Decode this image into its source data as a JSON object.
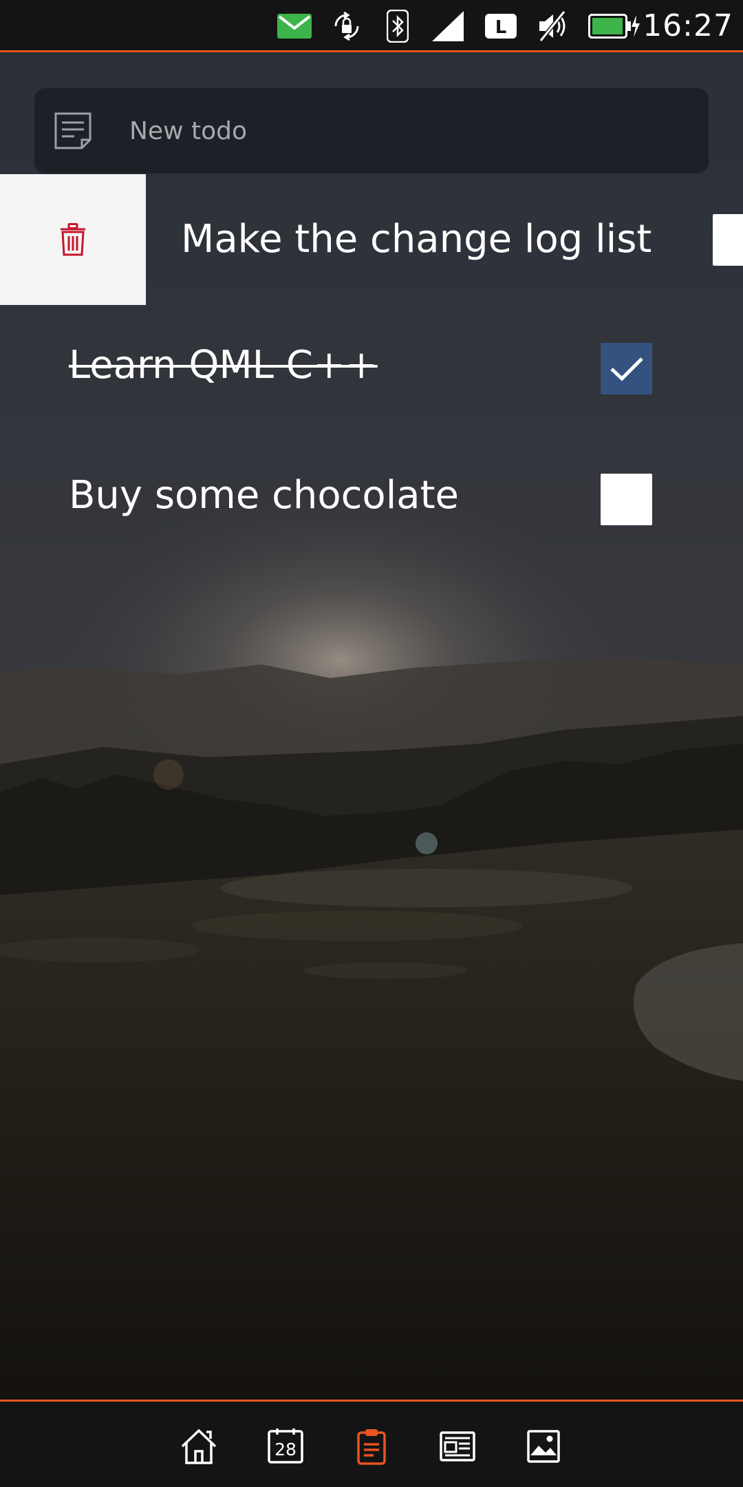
{
  "status_bar": {
    "time": "16:27",
    "icons": [
      "mail-icon",
      "rotation-lock-icon",
      "bluetooth-icon",
      "signal-icon",
      "lte-icon",
      "muted-icon",
      "battery-charging-icon"
    ],
    "network_letter": "L",
    "colors": {
      "mail": "#3db44a",
      "battery": "#3db44a",
      "accent": "#e95420"
    }
  },
  "new_todo": {
    "placeholder": "New todo",
    "value": "",
    "icon": "note-icon"
  },
  "todos": [
    {
      "text": "Make the change log list",
      "done": false,
      "swiped": true,
      "swipe_action_icon": "trash-icon"
    },
    {
      "text": "Learn QML C++",
      "done": true,
      "swiped": false
    },
    {
      "text": "Buy some chocolate",
      "done": false,
      "swiped": false
    }
  ],
  "dock": {
    "items": [
      {
        "icon": "home-icon",
        "active": false
      },
      {
        "icon": "calendar-icon",
        "label": "28",
        "active": false
      },
      {
        "icon": "clipboard-icon",
        "active": true
      },
      {
        "icon": "news-icon",
        "active": false
      },
      {
        "icon": "gallery-icon",
        "active": false
      }
    ],
    "active_color": "#e95420"
  }
}
